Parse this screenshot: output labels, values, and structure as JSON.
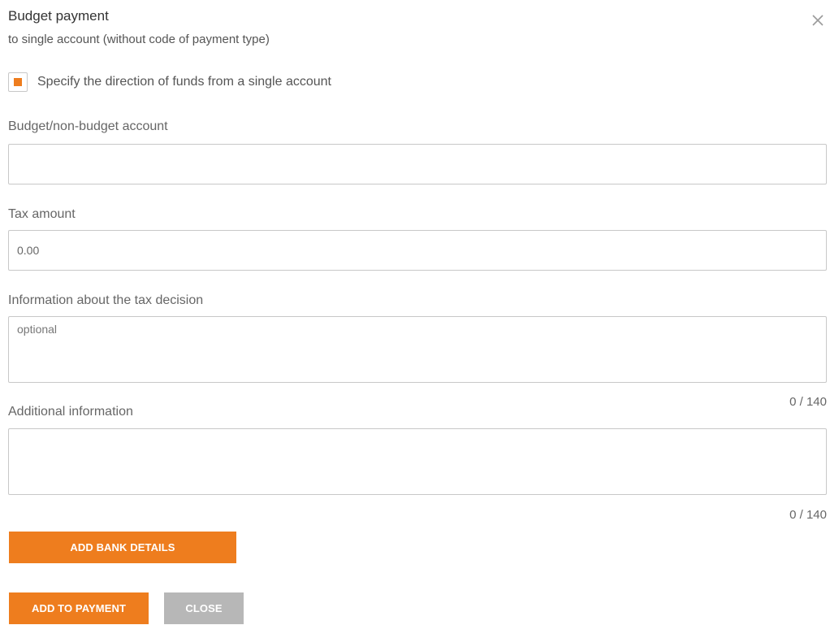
{
  "dialog": {
    "title": "Budget payment",
    "subtitle": "to single account (without code of payment type)",
    "close_icon": "close-icon"
  },
  "checkbox": {
    "label": "Specify the direction of funds from a single account",
    "checked": true
  },
  "fields": {
    "account": {
      "label": "Budget/non-budget account",
      "value": ""
    },
    "tax_amount": {
      "label": "Tax amount",
      "value": "0.00"
    },
    "tax_decision": {
      "label": "Information about the tax decision",
      "placeholder": "optional",
      "counter": "0 / 140"
    },
    "additional_info": {
      "label": "Additional information",
      "counter": "0 / 140"
    }
  },
  "buttons": {
    "add_bank_details": "ADD BANK DETAILS",
    "add_to_payment": "ADD TO PAYMENT",
    "close": "CLOSE"
  },
  "colors": {
    "accent": "#ee7d1e",
    "secondary_button": "#b7b7b7",
    "border": "#c8c8c8"
  }
}
